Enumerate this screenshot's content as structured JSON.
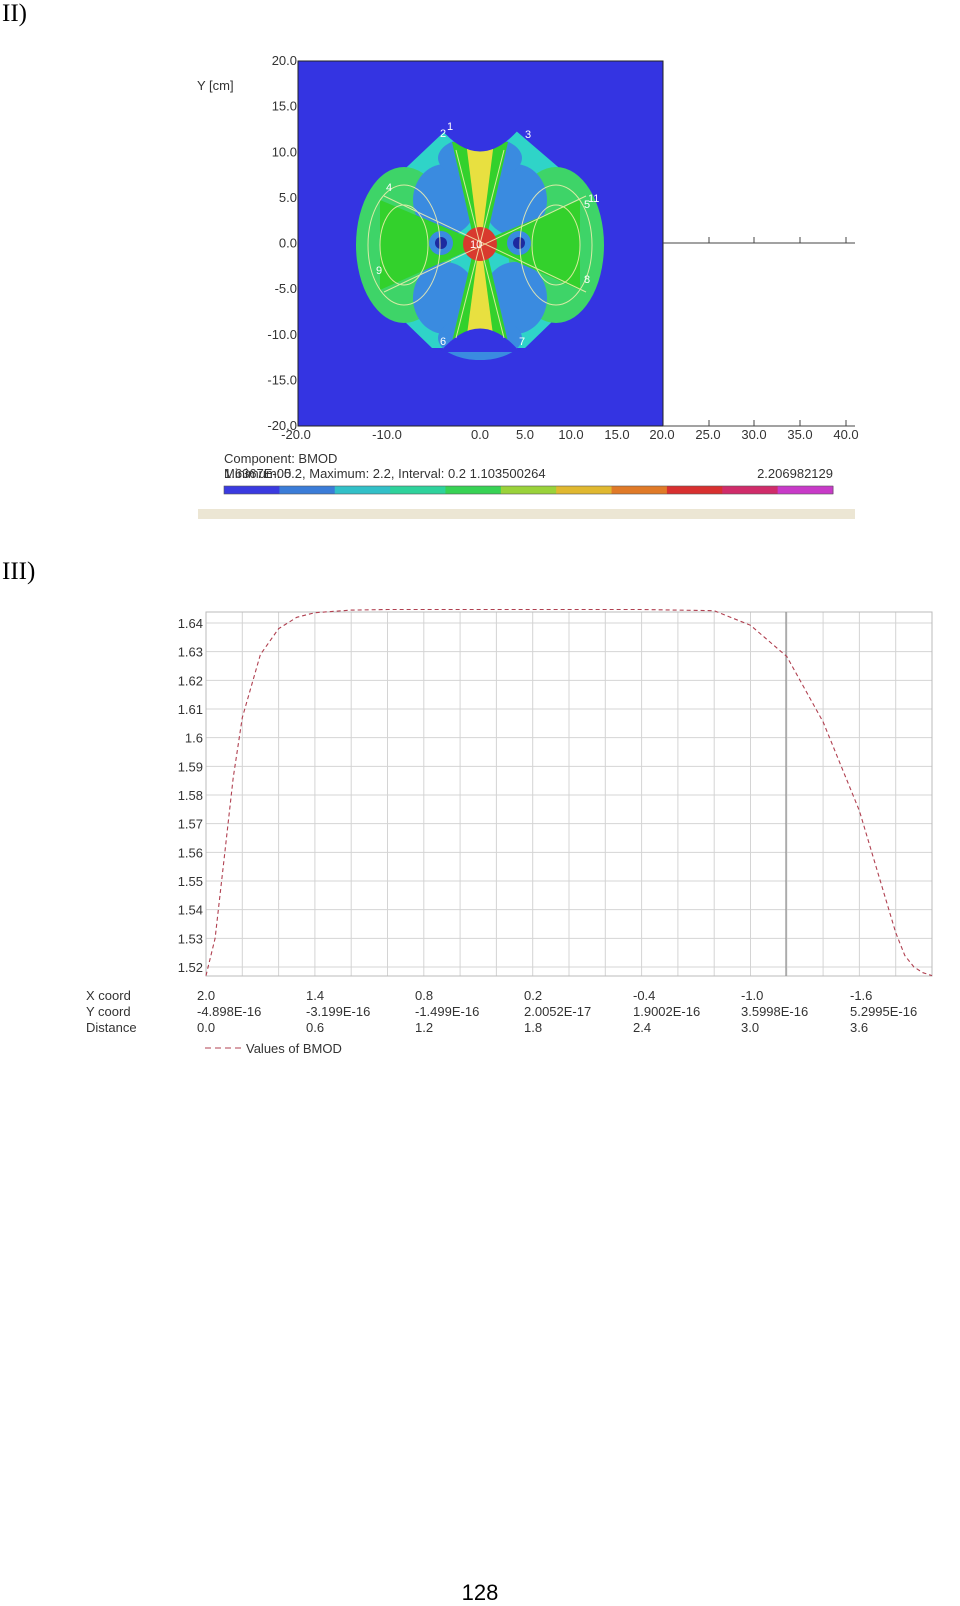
{
  "labels": {
    "fig2": "II)",
    "fig3": "III)"
  },
  "page_number": "128",
  "contour": {
    "y_axis_title": "Y [cm]",
    "y_ticks": [
      "20.0",
      "15.0",
      "10.0",
      "5.0",
      "0.0",
      "-5.0",
      "-10.0",
      "-15.0",
      "-20.0"
    ],
    "x_ticks": [
      "-20.0",
      "-10.0",
      "0.0",
      "5.0",
      "10.0",
      "15.0",
      "20.0",
      "25.0",
      "30.0",
      "35.0",
      "40.0"
    ],
    "component": "Component: BMOD",
    "scale_line": "Minimum: 0.2,   Maximum: 2.2,   Interval: 0.2     1.103500264",
    "scale_min_value": "1.6367E-05",
    "scale_max_value": "2.206982129",
    "contour_labels": [
      "1",
      "2",
      "3",
      "4",
      "5",
      "6",
      "7",
      "8",
      "9",
      "10",
      "11"
    ],
    "colorbar": [
      "#3a3ae0",
      "#3b7cd8",
      "#32c0c8",
      "#2ed29c",
      "#37d255",
      "#9ad23a",
      "#e0b830",
      "#e07a28",
      "#d83030",
      "#d02c6a",
      "#c83ac8"
    ],
    "colors": {
      "background": "#3434e2",
      "light_blue": "#3a8be0",
      "cyan": "#2fd4c8",
      "green": "#3ed468",
      "bright_green": "#33d12c",
      "yellow": "#e8e040",
      "red": "#d83a2e"
    }
  },
  "chart_data": {
    "type": "line",
    "title": "",
    "xlabel": "",
    "ylabel": "",
    "row_labels": [
      "X coord",
      "Y coord",
      "Distance"
    ],
    "x_coord_ticks": [
      "2.0",
      "1.4",
      "0.8",
      "0.2",
      "-0.4",
      "-1.0",
      "-1.6"
    ],
    "y_coord_ticks": [
      "-4.898E-16",
      "-3.199E-16",
      "-1.499E-16",
      "2.0052E-17",
      "1.9002E-16",
      "3.5998E-16",
      "5.2995E-16"
    ],
    "distance_ticks": [
      "0.0",
      "0.6",
      "1.2",
      "1.8",
      "2.4",
      "3.0",
      "3.6"
    ],
    "y_tick_labels": [
      "1.64",
      "1.63",
      "1.62",
      "1.61",
      "1.6",
      "1.59",
      "1.58",
      "1.57",
      "1.56",
      "1.55",
      "1.54",
      "1.53",
      "1.52"
    ],
    "xlim": [
      0,
      4.0
    ],
    "ylim": [
      1.5165,
      1.6435
    ],
    "legend": "Values of BMOD",
    "legend_position": "bottom",
    "line_color": "#b04050",
    "line_style": "dashed",
    "grid": true,
    "series": [
      {
        "x": [
          0.0,
          0.05,
          0.1,
          0.15,
          0.2,
          0.3,
          0.4,
          0.5,
          0.6,
          0.8,
          1.0,
          1.2,
          1.4,
          1.8,
          2.4,
          2.8,
          3.0,
          3.2,
          3.4,
          3.6,
          3.8,
          3.85,
          3.9,
          3.95,
          4.0
        ],
        "y": [
          1.517,
          1.53,
          1.558,
          1.586,
          1.607,
          1.629,
          1.638,
          1.642,
          1.6436,
          1.6445,
          1.6447,
          1.6447,
          1.6447,
          1.6447,
          1.6447,
          1.6443,
          1.6392,
          1.6283,
          1.6055,
          1.5745,
          1.532,
          1.524,
          1.52,
          1.518,
          1.517
        ]
      }
    ]
  }
}
